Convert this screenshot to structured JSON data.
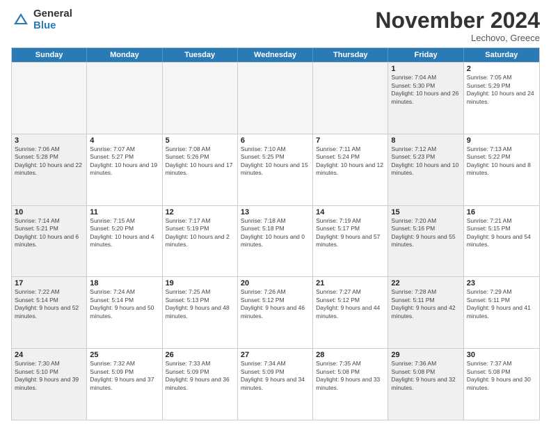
{
  "logo": {
    "general": "General",
    "blue": "Blue"
  },
  "title": "November 2024",
  "subtitle": "Lechovo, Greece",
  "weekdays": [
    "Sunday",
    "Monday",
    "Tuesday",
    "Wednesday",
    "Thursday",
    "Friday",
    "Saturday"
  ],
  "rows": [
    [
      {
        "day": "",
        "info": "",
        "empty": true
      },
      {
        "day": "",
        "info": "",
        "empty": true
      },
      {
        "day": "",
        "info": "",
        "empty": true
      },
      {
        "day": "",
        "info": "",
        "empty": true
      },
      {
        "day": "",
        "info": "",
        "empty": true
      },
      {
        "day": "1",
        "info": "Sunrise: 7:04 AM\nSunset: 5:30 PM\nDaylight: 10 hours and 26 minutes.",
        "shaded": true
      },
      {
        "day": "2",
        "info": "Sunrise: 7:05 AM\nSunset: 5:29 PM\nDaylight: 10 hours and 24 minutes.",
        "shaded": false
      }
    ],
    [
      {
        "day": "3",
        "info": "Sunrise: 7:06 AM\nSunset: 5:28 PM\nDaylight: 10 hours and 22 minutes.",
        "shaded": true
      },
      {
        "day": "4",
        "info": "Sunrise: 7:07 AM\nSunset: 5:27 PM\nDaylight: 10 hours and 19 minutes.",
        "shaded": false
      },
      {
        "day": "5",
        "info": "Sunrise: 7:08 AM\nSunset: 5:26 PM\nDaylight: 10 hours and 17 minutes.",
        "shaded": false
      },
      {
        "day": "6",
        "info": "Sunrise: 7:10 AM\nSunset: 5:25 PM\nDaylight: 10 hours and 15 minutes.",
        "shaded": false
      },
      {
        "day": "7",
        "info": "Sunrise: 7:11 AM\nSunset: 5:24 PM\nDaylight: 10 hours and 12 minutes.",
        "shaded": false
      },
      {
        "day": "8",
        "info": "Sunrise: 7:12 AM\nSunset: 5:23 PM\nDaylight: 10 hours and 10 minutes.",
        "shaded": true
      },
      {
        "day": "9",
        "info": "Sunrise: 7:13 AM\nSunset: 5:22 PM\nDaylight: 10 hours and 8 minutes.",
        "shaded": false
      }
    ],
    [
      {
        "day": "10",
        "info": "Sunrise: 7:14 AM\nSunset: 5:21 PM\nDaylight: 10 hours and 6 minutes.",
        "shaded": true
      },
      {
        "day": "11",
        "info": "Sunrise: 7:15 AM\nSunset: 5:20 PM\nDaylight: 10 hours and 4 minutes.",
        "shaded": false
      },
      {
        "day": "12",
        "info": "Sunrise: 7:17 AM\nSunset: 5:19 PM\nDaylight: 10 hours and 2 minutes.",
        "shaded": false
      },
      {
        "day": "13",
        "info": "Sunrise: 7:18 AM\nSunset: 5:18 PM\nDaylight: 10 hours and 0 minutes.",
        "shaded": false
      },
      {
        "day": "14",
        "info": "Sunrise: 7:19 AM\nSunset: 5:17 PM\nDaylight: 9 hours and 57 minutes.",
        "shaded": false
      },
      {
        "day": "15",
        "info": "Sunrise: 7:20 AM\nSunset: 5:16 PM\nDaylight: 9 hours and 55 minutes.",
        "shaded": true
      },
      {
        "day": "16",
        "info": "Sunrise: 7:21 AM\nSunset: 5:15 PM\nDaylight: 9 hours and 54 minutes.",
        "shaded": false
      }
    ],
    [
      {
        "day": "17",
        "info": "Sunrise: 7:22 AM\nSunset: 5:14 PM\nDaylight: 9 hours and 52 minutes.",
        "shaded": true
      },
      {
        "day": "18",
        "info": "Sunrise: 7:24 AM\nSunset: 5:14 PM\nDaylight: 9 hours and 50 minutes.",
        "shaded": false
      },
      {
        "day": "19",
        "info": "Sunrise: 7:25 AM\nSunset: 5:13 PM\nDaylight: 9 hours and 48 minutes.",
        "shaded": false
      },
      {
        "day": "20",
        "info": "Sunrise: 7:26 AM\nSunset: 5:12 PM\nDaylight: 9 hours and 46 minutes.",
        "shaded": false
      },
      {
        "day": "21",
        "info": "Sunrise: 7:27 AM\nSunset: 5:12 PM\nDaylight: 9 hours and 44 minutes.",
        "shaded": false
      },
      {
        "day": "22",
        "info": "Sunrise: 7:28 AM\nSunset: 5:11 PM\nDaylight: 9 hours and 42 minutes.",
        "shaded": true
      },
      {
        "day": "23",
        "info": "Sunrise: 7:29 AM\nSunset: 5:11 PM\nDaylight: 9 hours and 41 minutes.",
        "shaded": false
      }
    ],
    [
      {
        "day": "24",
        "info": "Sunrise: 7:30 AM\nSunset: 5:10 PM\nDaylight: 9 hours and 39 minutes.",
        "shaded": true
      },
      {
        "day": "25",
        "info": "Sunrise: 7:32 AM\nSunset: 5:09 PM\nDaylight: 9 hours and 37 minutes.",
        "shaded": false
      },
      {
        "day": "26",
        "info": "Sunrise: 7:33 AM\nSunset: 5:09 PM\nDaylight: 9 hours and 36 minutes.",
        "shaded": false
      },
      {
        "day": "27",
        "info": "Sunrise: 7:34 AM\nSunset: 5:09 PM\nDaylight: 9 hours and 34 minutes.",
        "shaded": false
      },
      {
        "day": "28",
        "info": "Sunrise: 7:35 AM\nSunset: 5:08 PM\nDaylight: 9 hours and 33 minutes.",
        "shaded": false
      },
      {
        "day": "29",
        "info": "Sunrise: 7:36 AM\nSunset: 5:08 PM\nDaylight: 9 hours and 32 minutes.",
        "shaded": true
      },
      {
        "day": "30",
        "info": "Sunrise: 7:37 AM\nSunset: 5:08 PM\nDaylight: 9 hours and 30 minutes.",
        "shaded": false
      }
    ]
  ]
}
